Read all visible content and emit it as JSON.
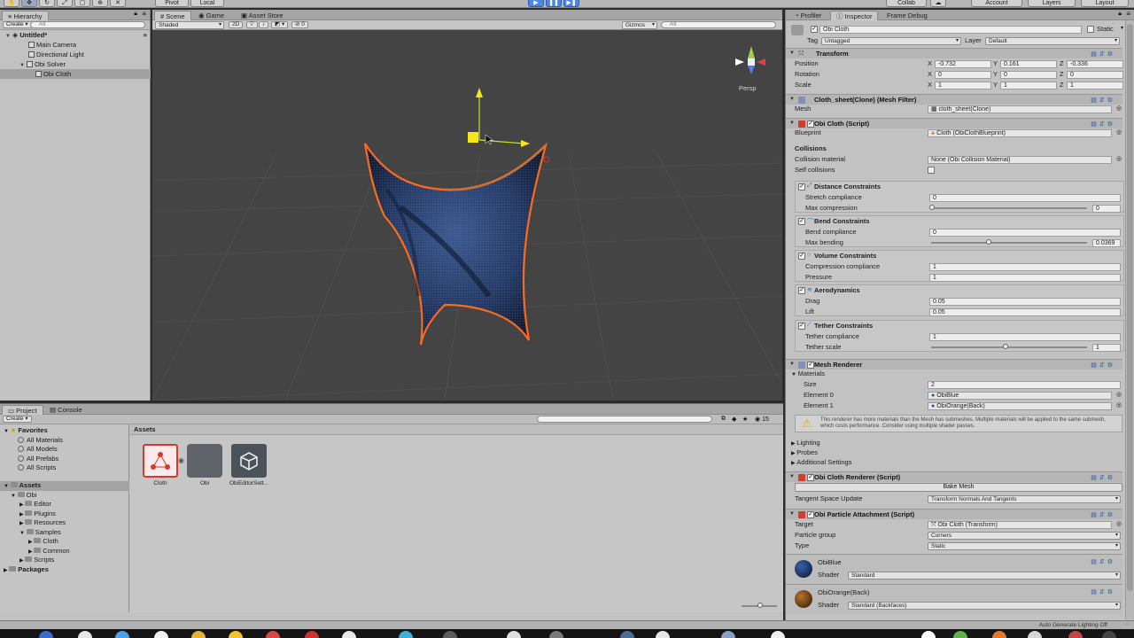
{
  "toolbar": {
    "pivot": "Pivot",
    "local": "Local",
    "collab": "Collab",
    "account": "Account",
    "layers": "Layers",
    "layout": "Layout"
  },
  "hierarchy": {
    "tab": "Hierarchy",
    "create": "Create",
    "search_placeholder": "All",
    "scene_name": "Untitled*",
    "items": [
      {
        "label": "Main Camera"
      },
      {
        "label": "Directional Light"
      },
      {
        "label": "Obi Solver"
      },
      {
        "label": "Obi Cloth"
      }
    ]
  },
  "scene": {
    "tabs": [
      "Scene",
      "Game",
      "Asset Store"
    ],
    "shading": "Shaded",
    "mode_2d": "2D",
    "gizmos": "Gizmos",
    "search_placeholder": "All",
    "persp": "Persp",
    "overlay_count": "0"
  },
  "inspector": {
    "tabs": [
      "Profiler",
      "Inspector",
      "Frame Debug"
    ],
    "object_name": "Obi Cloth",
    "static_label": "Static",
    "tag_label": "Tag",
    "tag_value": "Untagged",
    "layer_label": "Layer",
    "layer_value": "Default",
    "transform": {
      "title": "Transform",
      "position_label": "Position",
      "rotation_label": "Rotation",
      "scale_label": "Scale",
      "position": [
        "-0.732",
        "0.161",
        "-0.336"
      ],
      "rotation": [
        "0",
        "0",
        "0"
      ],
      "scale": [
        "1",
        "1",
        "1"
      ],
      "axes": [
        "X",
        "Y",
        "Z"
      ]
    },
    "mesh_filter": {
      "title": "Cloth_sheet(Clone) (Mesh Filter)",
      "mesh_label": "Mesh",
      "mesh_value": "cloth_sheet(Clone)"
    },
    "obi_cloth": {
      "title": "Obi Cloth (Script)",
      "blueprint_label": "Blueprint",
      "blueprint_value": "Cloth (ObiClothBlueprint)",
      "collisions_header": "Collisions",
      "collision_material_label": "Collision material",
      "collision_material_value": "None (Obi Collision Material)",
      "self_collisions_label": "Self collisions",
      "distance": {
        "title": "Distance Constraints",
        "stretch_label": "Stretch compliance",
        "stretch_value": "0",
        "max_compression_label": "Max compression",
        "max_compression_value": "0"
      },
      "bend": {
        "title": "Bend Constraints",
        "compliance_label": "Bend compliance",
        "compliance_value": "0",
        "max_bending_label": "Max bending",
        "max_bending_value": "0.0369"
      },
      "volume": {
        "title": "Volume Constraints",
        "compression_label": "Compression compliance",
        "compression_value": "1",
        "pressure_label": "Pressure",
        "pressure_value": "1"
      },
      "aero": {
        "title": "Aerodynamics",
        "drag_label": "Drag",
        "drag_value": "0.05",
        "lift_label": "Lift",
        "lift_value": "0.05"
      },
      "tether": {
        "title": "Tether Constraints",
        "compliance_label": "Tether compliance",
        "compliance_value": "1",
        "scale_label": "Tether scale",
        "scale_value": "1"
      }
    },
    "mesh_renderer": {
      "title": "Mesh Renderer",
      "materials_label": "Materials",
      "size_label": "Size",
      "size_value": "2",
      "element0_label": "Element 0",
      "element0_value": "ObiBlue",
      "element1_label": "Element 1",
      "element1_value": "ObiOrange(Back)",
      "warning": "This renderer has more materials than the Mesh has submeshes. Multiple materials will be applied to the same submesh, which costs performance. Consider using multiple shader passes.",
      "lighting": "Lighting",
      "probes": "Probes",
      "additional": "Additional Settings"
    },
    "cloth_renderer": {
      "title": "Obi Cloth Renderer (Script)",
      "bake_button": "Bake Mesh",
      "tangent_label": "Tangent Space Update",
      "tangent_value": "Transform Normals And Tangents"
    },
    "attachment": {
      "title": "Obi Particle Attachment (Script)",
      "target_label": "Target",
      "target_value": "Obi Cloth (Transform)",
      "group_label": "Particle group",
      "group_value": "Corners",
      "type_label": "Type",
      "type_value": "Static"
    },
    "materials": [
      {
        "name": "ObiBlue",
        "shader_label": "Shader",
        "shader_value": "Standard",
        "color": "#1d2d55"
      },
      {
        "name": "ObiOrange(Back)",
        "shader_label": "Shader",
        "shader_value": "Standard (Backfaces)",
        "color": "#8a4a12"
      }
    ]
  },
  "project": {
    "tabs": [
      "Project",
      "Console"
    ],
    "create": "Create",
    "favorites_label": "Favorites",
    "favorites": [
      "All Materials",
      "All Models",
      "All Prefabs",
      "All Scripts"
    ],
    "assets_label": "Assets",
    "tree": [
      {
        "label": "Obi",
        "depth": 1
      },
      {
        "label": "Editor",
        "depth": 2
      },
      {
        "label": "Plugins",
        "depth": 2
      },
      {
        "label": "Resources",
        "depth": 2
      },
      {
        "label": "Samples",
        "depth": 2
      },
      {
        "label": "Cloth",
        "depth": 3
      },
      {
        "label": "Common",
        "depth": 3
      },
      {
        "label": "Scripts",
        "depth": 2
      }
    ],
    "packages_label": "Packages",
    "breadcrumb": "Assets",
    "assets": [
      {
        "label": "Cloth"
      },
      {
        "label": "Obi"
      },
      {
        "label": "ObiEditorSett..."
      }
    ],
    "badge_count": "15"
  },
  "status": {
    "lighting": "Auto Generate Lighting Off"
  }
}
